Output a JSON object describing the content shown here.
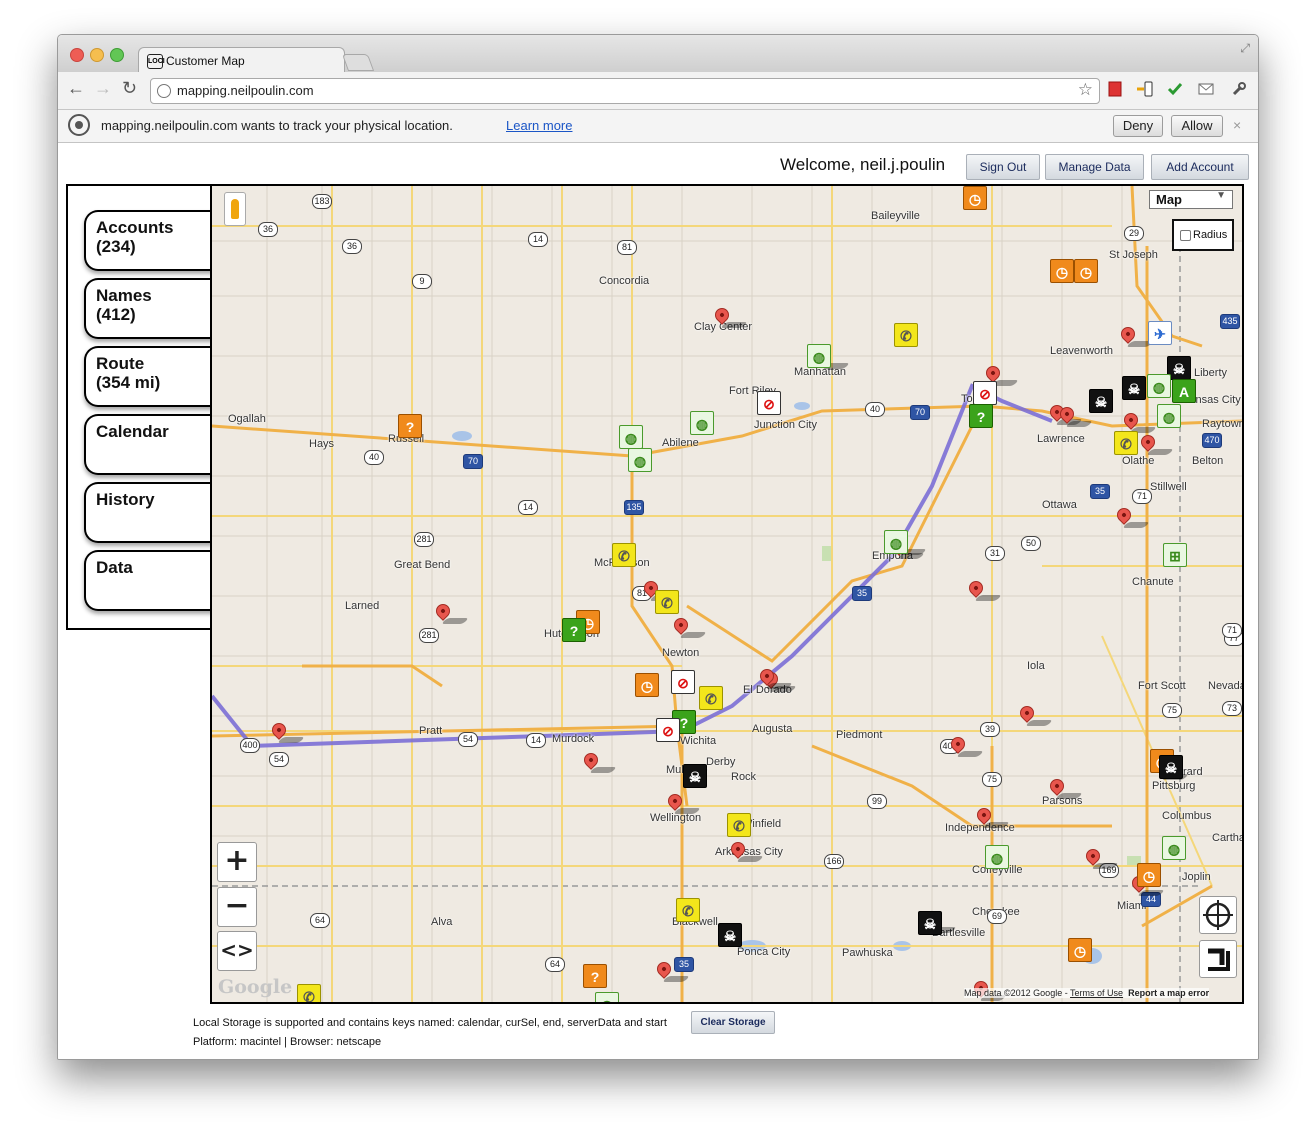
{
  "browser": {
    "tab_title": "Customer Map",
    "tab_favicon_text": "LOCI",
    "url": "mapping.neilpoulin.com",
    "infobar_message": "mapping.neilpoulin.com wants to track your physical location.",
    "infobar_link": "Learn more",
    "deny_label": "Deny",
    "allow_label": "Allow",
    "close_glyph": "×"
  },
  "header": {
    "welcome": "Welcome, neil.j.poulin",
    "sign_out": "Sign Out",
    "manage_data": "Manage Data",
    "add_account": "Add Account"
  },
  "sidebar": {
    "items": [
      {
        "label": "Accounts\n(234)"
      },
      {
        "label": "Names\n(412)"
      },
      {
        "label": "Route\n(354 mi)"
      },
      {
        "label": "Calendar"
      },
      {
        "label": "History"
      },
      {
        "label": "Data"
      }
    ]
  },
  "map": {
    "type_select": "Map",
    "radius_label": "Radius",
    "google_logo": "Google",
    "attribution": "Map data ©2012 Google - ",
    "terms": "Terms of Use",
    "report": "Report a map error",
    "places": [
      "Baileyville",
      "St Joseph",
      "Concordia",
      "Clay Center",
      "Leavenworth",
      "Manhattan",
      "Fort Riley",
      "Junction City",
      "Abilene",
      "Hays",
      "Russell",
      "Topeka",
      "Lawrence",
      "Kansas City",
      "Olathe",
      "Belton",
      "Raytown",
      "Liberty",
      "Ogallah",
      "Ottawa",
      "Stillwell",
      "McPherson",
      "Great Bend",
      "Emporia",
      "Larned",
      "Hutchinson",
      "Newton",
      "El Dorado",
      "Pratt",
      "Murdock",
      "Augusta",
      "Wichita",
      "Derby",
      "Mulvane",
      "Rock",
      "Piedmont",
      "Iola",
      "Fort Scott",
      "Nevada",
      "Pittsburg",
      "Wellington",
      "Winfield",
      "Arkansas City",
      "Independence",
      "Parsons",
      "Coffeyville",
      "Columbus",
      "Carthage",
      "Joplin",
      "Miami",
      "Alva",
      "Blackwell",
      "Ponca City",
      "Pawhuska",
      "Bartlesville",
      "Chanute",
      "Girard",
      "Cherokee"
    ],
    "highways": [
      "183",
      "36",
      "36",
      "14",
      "81",
      "9",
      "40",
      "70",
      "40",
      "70",
      "135",
      "281",
      "14",
      "50",
      "35",
      "31",
      "35",
      "81",
      "281",
      "54",
      "54",
      "14",
      "400",
      "99",
      "75",
      "166",
      "64",
      "64",
      "69",
      "44",
      "35",
      "77",
      "73",
      "71",
      "29",
      "435",
      "470",
      "71",
      "400",
      "39",
      "75",
      "169"
    ],
    "controls": {
      "zoom_in": "+",
      "zoom_out": "−",
      "pan": "<>"
    }
  },
  "footer": {
    "storage_text": "Local Storage is supported and contains keys named: calendar, curSel, end, serverData and start",
    "clear_storage": "Clear Storage",
    "platform_text": "Platform: macintel | Browser: netscape"
  },
  "colors": {
    "route": "#7b6fd6",
    "pin_red": "#e8564d",
    "marker_orange": "#f08a1c",
    "marker_yellow": "#f3e61b",
    "marker_green": "#3ba31b",
    "map_bg": "#efeae2",
    "road_yellow": "#f4c24a",
    "button_text": "#1a2a5c"
  },
  "icons": {
    "marker_types": [
      "red-pin-icon",
      "clock-icon",
      "phone-icon",
      "globe-icon",
      "question-icon",
      "skull-icon",
      "no-entry-icon",
      "airport-icon",
      "bus-icon"
    ]
  }
}
